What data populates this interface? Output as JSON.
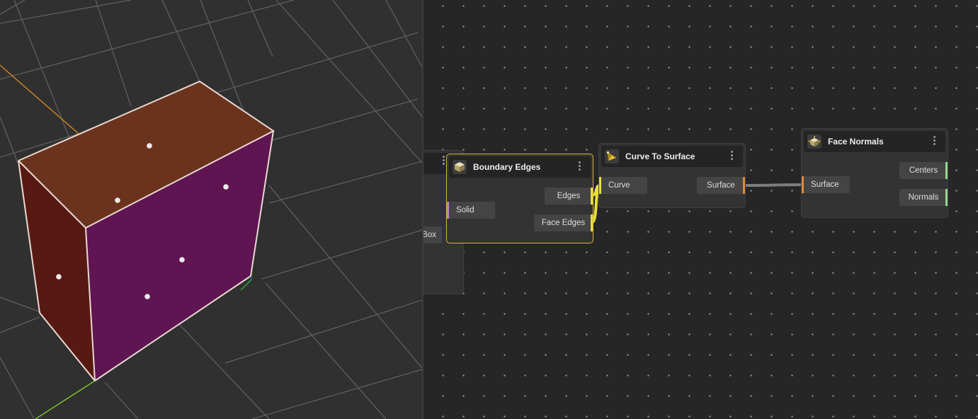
{
  "colors": {
    "selection": "#d9b43c",
    "solid_port": "#c080d0",
    "surface_port": "#e0893a",
    "vector_port": "#8fdb8f",
    "curve_wire": "#e6e03c",
    "box_top_face": "#6b331d",
    "box_left_face": "#561a12",
    "box_front_face": "#5f1552"
  },
  "viewport": {
    "face_point_count": 6
  },
  "nodes": {
    "box": {
      "output_label": "Box"
    },
    "boundary_edges": {
      "title": "Boundary Edges",
      "icon": "cube-icon",
      "menu": "⋮",
      "input": "Solid",
      "outputs": [
        "Edges",
        "Face Edges"
      ]
    },
    "curve_to_surface": {
      "title": "Curve To Surface",
      "icon": "pyramid-icon",
      "menu": "⋮",
      "input": "Curve",
      "output": "Surface"
    },
    "face_normals": {
      "title": "Face Normals",
      "icon": "cube-arrows-icon",
      "menu": "⋮",
      "input": "Surface",
      "outputs": [
        "Centers",
        "Normals"
      ]
    }
  }
}
